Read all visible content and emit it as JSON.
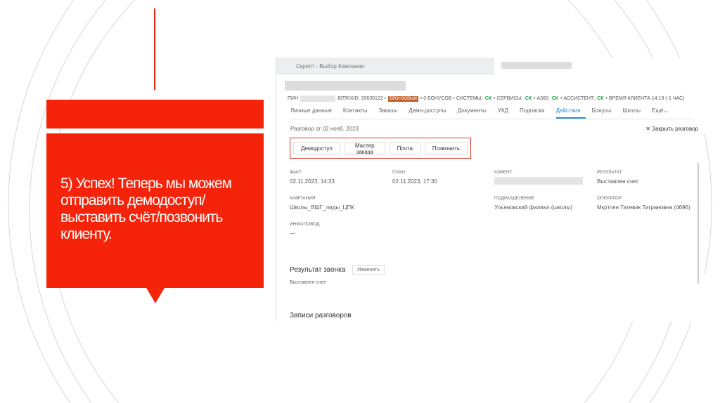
{
  "slide": {
    "text": "5) Успех! Теперь мы можем отправить демодоступ/выставить счёт/позвонить клиенту.",
    "accent": "#f5230a"
  },
  "app": {
    "tab": "Скрипт - Выбор Кампании",
    "meta": {
      "pin": "ПИН",
      "bitrix": "BITRIXID: 20635122 •",
      "badge": "БРОНЗОВЫЙ",
      "bonus": "• 0 БОНУСОВ • СИСТЕМЫ:",
      "ck": "СК",
      "services": "• СЕРВИСЫ:",
      "a360": "• А360:",
      "assistant": "• АССИСТЕНТ:",
      "time": "• ВРЕМЯ КЛИЕНТА 14:19 (-1 ЧАС)"
    },
    "tabs": [
      "Личные данные",
      "Контакты",
      "Заказы",
      "Демо-доступы",
      "Документы",
      "УКД",
      "Подписки",
      "Действия",
      "Бонусы",
      "Школы",
      "Ещё⌄"
    ],
    "conversation": "Разговор от 02 нояб. 2023",
    "close": "Закрыть разговор",
    "actions": [
      "Демодоступ",
      "Мастер заказа",
      "Почта",
      "Позвонить"
    ],
    "fields": {
      "fact": {
        "label": "ФАКТ",
        "value": "02.11.2023, 14:33"
      },
      "plan": {
        "label": "ПЛАН",
        "value": "02.11.2023, 17:30"
      },
      "client": {
        "label": "КЛИЕНТ"
      },
      "result": {
        "label": "РЕЗУЛЬТАТ",
        "value": "Выставлен счет"
      },
      "campaign": {
        "label": "КАМПАНИЯ",
        "value": "Школы_ВШГ_лиды_ЦПК"
      },
      "division": {
        "label": "ПОДРАЗДЕЛЕНИЕ",
        "value": "Ульяновский филиал (школы)"
      },
      "operator": {
        "label": "ОПЕРАТОР",
        "value": "Мкртчян Татевик Тиграновна (4696)"
      },
      "info": {
        "label": "ИНФОПОВОД",
        "value": "—"
      }
    },
    "call_result": {
      "title": "Результат звонка",
      "edit": "Изменить",
      "value": "Выставлен счет"
    },
    "records": "Записи разговоров"
  }
}
